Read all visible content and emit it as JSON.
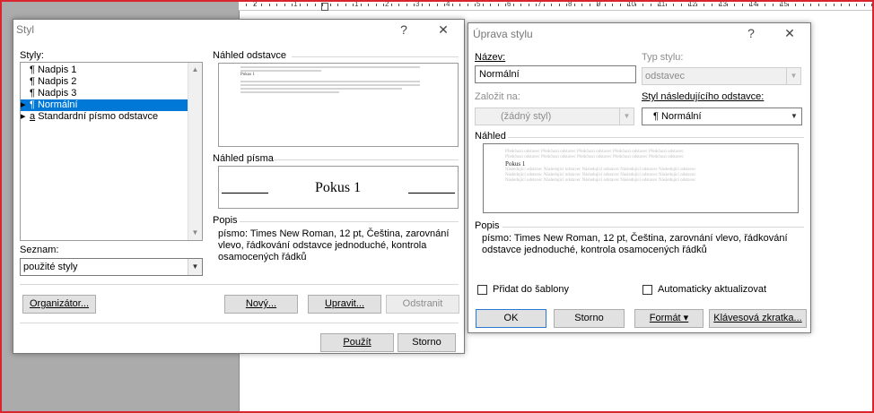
{
  "ruler": {
    "numbers": [
      "2",
      "1",
      "1",
      "2",
      "3",
      "4",
      "5",
      "6",
      "7",
      "8",
      "9",
      "10",
      "11",
      "12",
      "13",
      "14",
      "15"
    ]
  },
  "styl_dialog": {
    "title": "Styl",
    "help": "?",
    "close": "✕",
    "styles_label": "Styly:",
    "styles": [
      {
        "label": "Nadpis 1",
        "mark": "¶",
        "expander": "",
        "selected": false
      },
      {
        "label": "Nadpis 2",
        "mark": "¶",
        "expander": "",
        "selected": false
      },
      {
        "label": "Nadpis 3",
        "mark": "¶",
        "expander": "",
        "selected": false
      },
      {
        "label": "Normální",
        "mark": "¶",
        "expander": "▸",
        "selected": true
      },
      {
        "label": "Standardní písmo odstavce",
        "mark": "a",
        "expander": "▸",
        "selected": false
      }
    ],
    "seznam_label": "Seznam:",
    "seznam_value": "použité styly",
    "paragraph_preview_label": "Náhled odstavce",
    "paragraph_preview_text": "Pokus 1",
    "font_preview_label": "Náhled písma",
    "font_preview_text": "Pokus 1",
    "popis_label": "Popis",
    "popis_text": [
      "písmo: Times New Roman, 12 pt, Čeština, zarovnání",
      "vlevo, řádkování odstavce jednoduché, kontrola",
      "osamocených řádků"
    ],
    "organizer_button": "Organizátor...",
    "new_button": "Nový...",
    "modify_button": "Upravit...",
    "delete_button": "Odstranit",
    "apply_button": "Použít",
    "cancel_button": "Storno"
  },
  "uprava_dialog": {
    "title": "Úprava stylu",
    "help": "?",
    "close": "✕",
    "name_label": "Název:",
    "name_value": "Normální",
    "type_label": "Typ stylu:",
    "type_value": "odstavec",
    "based_on_label": "Založit na:",
    "based_on_value": "(žádný styl)",
    "next_style_label": "Styl následujícího odstavce:",
    "next_style_value": "¶ Normální",
    "preview_label": "Náhled",
    "preview_filler": "Předchozí odstavec Předchozí odstavec Předchozí odstavec Předchozí odstavec Předchozí odstavec",
    "preview_text": "Pokus 1",
    "following_filler": "Následující odstavec Následující odstavec Následující odstavec Následující odstavec Následující odstavec",
    "popis_label": "Popis",
    "popis_text": [
      "písmo: Times New Roman, 12 pt, Čeština, zarovnání vlevo, řádkování",
      "odstavce jednoduché, kontrola osamocených řádků"
    ],
    "add_template_label": "Přidat do šablony",
    "add_template_checked": false,
    "auto_update_label": "Automaticky aktualizovat",
    "auto_update_checked": false,
    "ok_button": "OK",
    "cancel_button": "Storno",
    "format_button": "Formát ▾",
    "shortcut_button": "Klávesová zkratka..."
  }
}
